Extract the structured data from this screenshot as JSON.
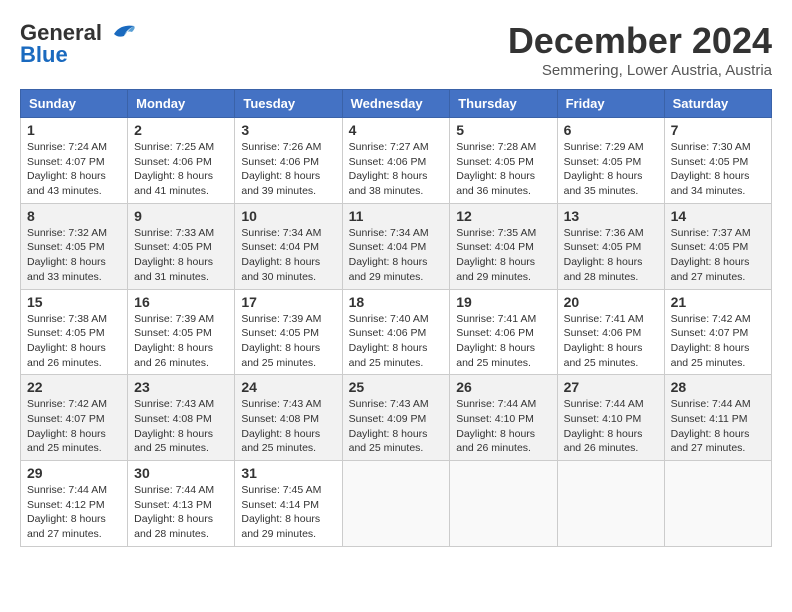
{
  "logo": {
    "line1": "General",
    "line2": "Blue"
  },
  "title": "December 2024",
  "subtitle": "Semmering, Lower Austria, Austria",
  "headers": [
    "Sunday",
    "Monday",
    "Tuesday",
    "Wednesday",
    "Thursday",
    "Friday",
    "Saturday"
  ],
  "weeks": [
    [
      {
        "day": "1",
        "sunrise": "7:24 AM",
        "sunset": "4:07 PM",
        "daylight": "8 hours and 43 minutes."
      },
      {
        "day": "2",
        "sunrise": "7:25 AM",
        "sunset": "4:06 PM",
        "daylight": "8 hours and 41 minutes."
      },
      {
        "day": "3",
        "sunrise": "7:26 AM",
        "sunset": "4:06 PM",
        "daylight": "8 hours and 39 minutes."
      },
      {
        "day": "4",
        "sunrise": "7:27 AM",
        "sunset": "4:06 PM",
        "daylight": "8 hours and 38 minutes."
      },
      {
        "day": "5",
        "sunrise": "7:28 AM",
        "sunset": "4:05 PM",
        "daylight": "8 hours and 36 minutes."
      },
      {
        "day": "6",
        "sunrise": "7:29 AM",
        "sunset": "4:05 PM",
        "daylight": "8 hours and 35 minutes."
      },
      {
        "day": "7",
        "sunrise": "7:30 AM",
        "sunset": "4:05 PM",
        "daylight": "8 hours and 34 minutes."
      }
    ],
    [
      {
        "day": "8",
        "sunrise": "7:32 AM",
        "sunset": "4:05 PM",
        "daylight": "8 hours and 33 minutes."
      },
      {
        "day": "9",
        "sunrise": "7:33 AM",
        "sunset": "4:05 PM",
        "daylight": "8 hours and 31 minutes."
      },
      {
        "day": "10",
        "sunrise": "7:34 AM",
        "sunset": "4:04 PM",
        "daylight": "8 hours and 30 minutes."
      },
      {
        "day": "11",
        "sunrise": "7:34 AM",
        "sunset": "4:04 PM",
        "daylight": "8 hours and 29 minutes."
      },
      {
        "day": "12",
        "sunrise": "7:35 AM",
        "sunset": "4:04 PM",
        "daylight": "8 hours and 29 minutes."
      },
      {
        "day": "13",
        "sunrise": "7:36 AM",
        "sunset": "4:05 PM",
        "daylight": "8 hours and 28 minutes."
      },
      {
        "day": "14",
        "sunrise": "7:37 AM",
        "sunset": "4:05 PM",
        "daylight": "8 hours and 27 minutes."
      }
    ],
    [
      {
        "day": "15",
        "sunrise": "7:38 AM",
        "sunset": "4:05 PM",
        "daylight": "8 hours and 26 minutes."
      },
      {
        "day": "16",
        "sunrise": "7:39 AM",
        "sunset": "4:05 PM",
        "daylight": "8 hours and 26 minutes."
      },
      {
        "day": "17",
        "sunrise": "7:39 AM",
        "sunset": "4:05 PM",
        "daylight": "8 hours and 25 minutes."
      },
      {
        "day": "18",
        "sunrise": "7:40 AM",
        "sunset": "4:06 PM",
        "daylight": "8 hours and 25 minutes."
      },
      {
        "day": "19",
        "sunrise": "7:41 AM",
        "sunset": "4:06 PM",
        "daylight": "8 hours and 25 minutes."
      },
      {
        "day": "20",
        "sunrise": "7:41 AM",
        "sunset": "4:06 PM",
        "daylight": "8 hours and 25 minutes."
      },
      {
        "day": "21",
        "sunrise": "7:42 AM",
        "sunset": "4:07 PM",
        "daylight": "8 hours and 25 minutes."
      }
    ],
    [
      {
        "day": "22",
        "sunrise": "7:42 AM",
        "sunset": "4:07 PM",
        "daylight": "8 hours and 25 minutes."
      },
      {
        "day": "23",
        "sunrise": "7:43 AM",
        "sunset": "4:08 PM",
        "daylight": "8 hours and 25 minutes."
      },
      {
        "day": "24",
        "sunrise": "7:43 AM",
        "sunset": "4:08 PM",
        "daylight": "8 hours and 25 minutes."
      },
      {
        "day": "25",
        "sunrise": "7:43 AM",
        "sunset": "4:09 PM",
        "daylight": "8 hours and 25 minutes."
      },
      {
        "day": "26",
        "sunrise": "7:44 AM",
        "sunset": "4:10 PM",
        "daylight": "8 hours and 26 minutes."
      },
      {
        "day": "27",
        "sunrise": "7:44 AM",
        "sunset": "4:10 PM",
        "daylight": "8 hours and 26 minutes."
      },
      {
        "day": "28",
        "sunrise": "7:44 AM",
        "sunset": "4:11 PM",
        "daylight": "8 hours and 27 minutes."
      }
    ],
    [
      {
        "day": "29",
        "sunrise": "7:44 AM",
        "sunset": "4:12 PM",
        "daylight": "8 hours and 27 minutes."
      },
      {
        "day": "30",
        "sunrise": "7:44 AM",
        "sunset": "4:13 PM",
        "daylight": "8 hours and 28 minutes."
      },
      {
        "day": "31",
        "sunrise": "7:45 AM",
        "sunset": "4:14 PM",
        "daylight": "8 hours and 29 minutes."
      },
      null,
      null,
      null,
      null
    ]
  ]
}
